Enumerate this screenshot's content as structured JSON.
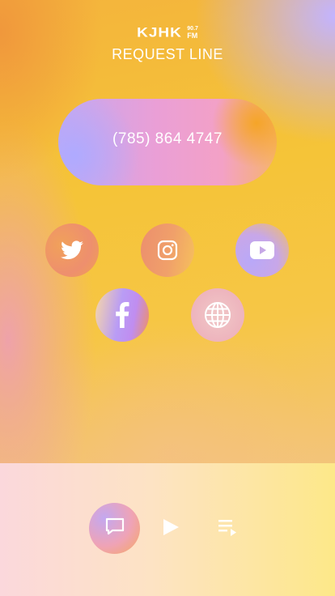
{
  "header": {
    "logo_main": "KJHK",
    "logo_freq": "90.7",
    "logo_band": "FM",
    "title": "REQUEST LINE"
  },
  "phone": {
    "number": "(785) 864 4747"
  },
  "social": [
    {
      "icon": "twitter-icon"
    },
    {
      "icon": "instagram-icon"
    },
    {
      "icon": "youtube-icon"
    },
    {
      "icon": "facebook-icon"
    },
    {
      "icon": "globe-icon"
    }
  ],
  "player": {
    "buttons": [
      "chat-icon",
      "play-icon",
      "queue-icon"
    ]
  },
  "colors": {
    "background_yellow": "#f5c438",
    "bottom_bar_left": "#fbd8dc",
    "bottom_bar_right": "#fde889",
    "text": "#ffffff"
  }
}
